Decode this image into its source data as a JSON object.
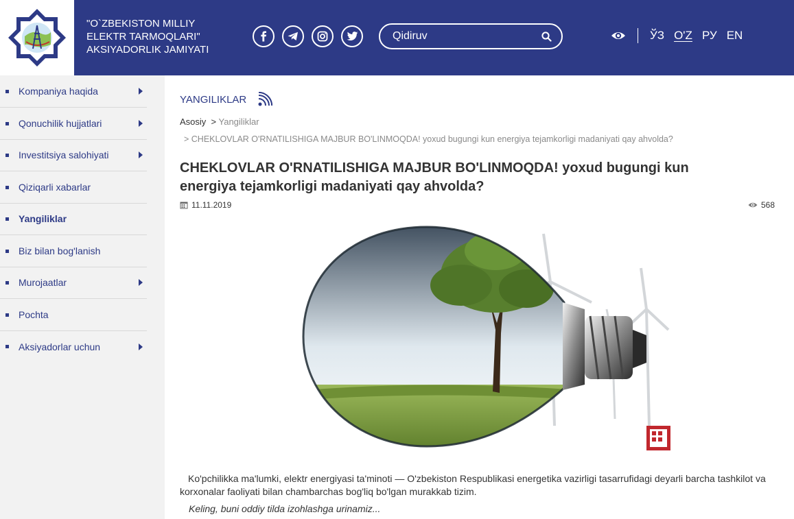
{
  "header": {
    "company_line1": "\"O`ZBEKISTON MILLIY",
    "company_line2": "ELEKTR TARMOQLARI\"",
    "company_line3": "AKSIYADORLIK JAMIYATI",
    "social": [
      "facebook-icon",
      "telegram-icon",
      "instagram-icon",
      "twitter-icon"
    ],
    "search_placeholder": "Qidiruv",
    "languages": [
      {
        "label": "ЎЗ",
        "active": false
      },
      {
        "label": "O'Z",
        "active": true
      },
      {
        "label": "РУ",
        "active": false
      },
      {
        "label": "EN",
        "active": false
      }
    ]
  },
  "sidebar": {
    "items": [
      {
        "label": "Kompaniya haqida",
        "arrow": true
      },
      {
        "label": "Qonuchilik hujjatlari",
        "arrow": true
      },
      {
        "label": "Investitsiya salohiyati",
        "arrow": true
      },
      {
        "label": "Qiziqarli xabarlar",
        "arrow": false
      },
      {
        "label": "Yangiliklar",
        "arrow": false,
        "active": true
      },
      {
        "label": "Biz bilan bog'lanish",
        "arrow": false
      },
      {
        "label": "Murojaatlar",
        "arrow": true
      },
      {
        "label": "Pochta",
        "arrow": false
      },
      {
        "label": "Aksiyadorlar uchun",
        "arrow": true
      }
    ]
  },
  "main": {
    "section_title": "YANGILIKLAR",
    "breadcrumb": {
      "home": "Asosiy",
      "sep": ">",
      "section": "Yangiliklar",
      "current": "> CHEKLOVLAR O'RNATILISHIGA MAJBUR BO'LINMOQDA! yoxud bugungi kun energiya tejamkorligi madaniyati qay ahvolda?"
    },
    "article_title_line1": "CHEKLOVLAR O'RNATILISHIGA MAJBUR BO'LINMOQDA! yoxud bugungi kun",
    "article_title_line2": "energiya tejamkorligi madaniyati qay ahvolda?",
    "date": "11.11.2019",
    "views": "568",
    "paragraph": "Ko'pchilikka ma'lumki, elektr energiyasi ta'minoti — O'zbekiston Respublikasi energetika vazirligi tasarrufidagi deyarli barcha tashkilot va korxonalar faoliyati bilan chambarchas bog'liq bo'lgan murakkab tizim.",
    "italic": "Keling, buni oddiy tilda izohlashga urinamiz..."
  },
  "colors": {
    "brand": "#2d3a86",
    "sidebar_bg": "#f2f2f2",
    "muted": "#8a8a8a"
  }
}
